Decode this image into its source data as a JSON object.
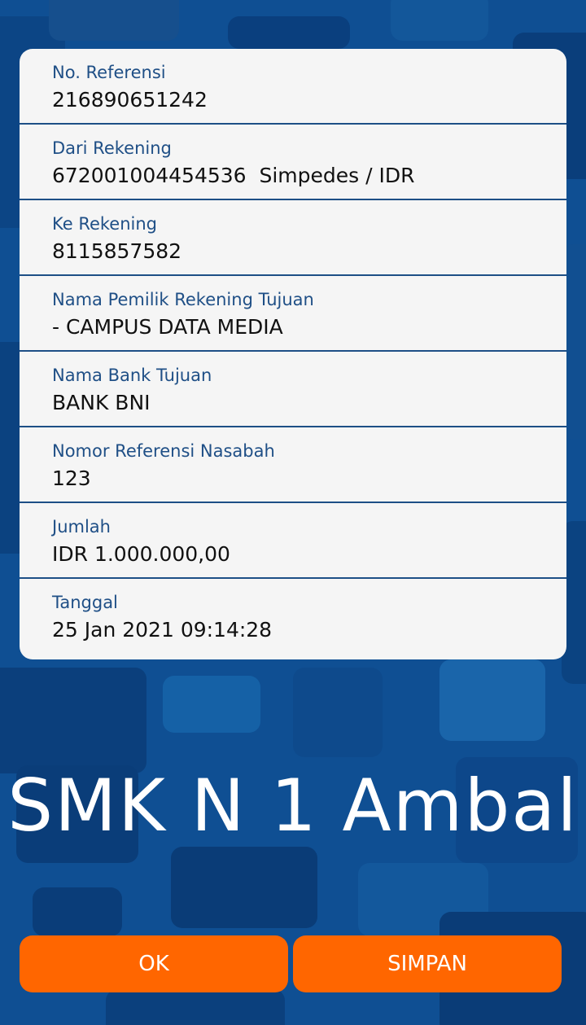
{
  "details": [
    {
      "label": "No. Referensi",
      "value": "216890651242"
    },
    {
      "label": "Dari Rekening",
      "value": "672001004454536  Simpedes / IDR"
    },
    {
      "label": "Ke Rekening",
      "value": "8115857582"
    },
    {
      "label": "Nama Pemilik Rekening Tujuan",
      "value": "- CAMPUS DATA MEDIA"
    },
    {
      "label": "Nama Bank Tujuan",
      "value": "BANK BNI"
    },
    {
      "label": "Nomor Referensi Nasabah",
      "value": "123"
    },
    {
      "label": "Jumlah",
      "value": "IDR 1.000.000,00"
    },
    {
      "label": "Tanggal",
      "value": "25 Jan 2021 09:14:28"
    }
  ],
  "watermark": "SMK N 1 Ambal",
  "buttons": {
    "ok": "OK",
    "simpan": "SIMPAN"
  },
  "colors": {
    "background": "#0f4f93",
    "accent": "#ff6600",
    "label": "#1f4f86",
    "card": "#f5f5f5"
  }
}
